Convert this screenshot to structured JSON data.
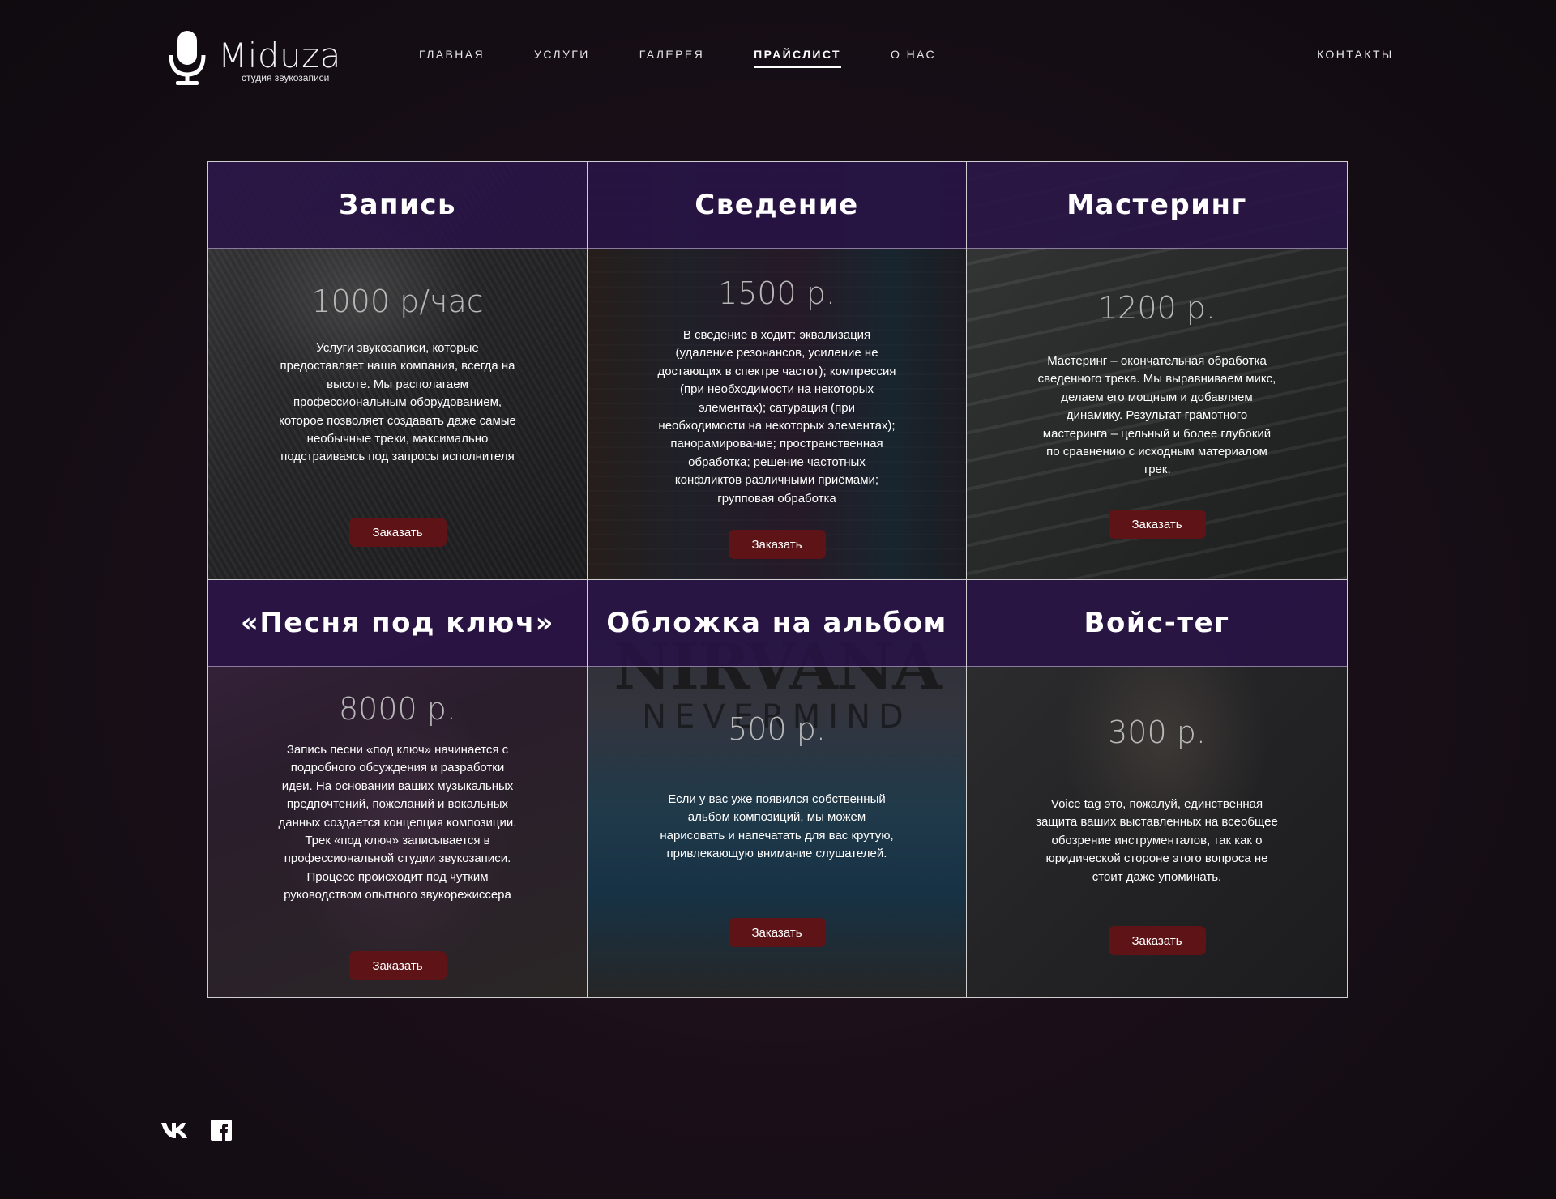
{
  "brand": {
    "name": "Miduza",
    "tagline": "студия звукозаписи"
  },
  "nav": {
    "items": [
      {
        "label": "ГЛАВНАЯ"
      },
      {
        "label": "УСЛУГИ"
      },
      {
        "label": "ГАЛЕРЕЯ"
      },
      {
        "label": "ПРАЙСЛИСТ",
        "active": true
      },
      {
        "label": "О НАС"
      }
    ],
    "contacts": "КОНТАКТЫ"
  },
  "cards": [
    {
      "title": "Запись",
      "price": "1000 р/час",
      "description": "Услуги звукозаписи, которые предоставляет наша компания, всегда на высоте. Мы располагаем профессиональным оборудованием, которое позволяет создавать даже самые необычные треки, максимально подстраиваясь под запросы исполнителя",
      "button": "Заказать"
    },
    {
      "title": "Сведение",
      "price": "1500 р.",
      "description": "В сведение в ходит: эквализация (удаление резонансов, усиление не достающих в спектре частот); компрессия (при необходимости на некоторых элементах); сатурация (при необходимости на некоторых элементах); панорамирование; пространственная обработка; решение частотных конфликтов различными приёмами; групповая обработка",
      "button": "Заказать"
    },
    {
      "title": "Мастеринг",
      "price": "1200 р.",
      "description": "Мастеринг – окончательная обработка сведенного трека. Мы выравниваем микс, делаем его мощным и добавляем динамику. Результат грамотного мастеринга – цельный и более глубокий по сравнению с исходным материалом трек.",
      "button": "Заказать"
    },
    {
      "title": "«Песня под ключ»",
      "price": "8000 р.",
      "description": "Запись песни «под ключ» начинается с подробного обсуждения и разработки идеи. На основании ваших музыкальных предпочтений, пожеланий и вокальных данных создается концепция композиции. Трек «под ключ» записывается в профессиональной студии звукозаписи. Процесс происходит под чутким руководством опытного звукорежиссера",
      "button": "Заказать"
    },
    {
      "title": "Обложка на альбом",
      "price": "500 р.",
      "description": "Если у вас уже появился собственный альбом композиций, мы можем нарисовать и напечатать для вас крутую, привлекающую внимание слушателей.",
      "button": "Заказать",
      "image_text": {
        "band": "NIRVANA",
        "album": "NEVERMIND"
      }
    },
    {
      "title": "Войс-тег",
      "price": "300 р.",
      "description": "Voice tag это, пожалуй, единственная защита ваших выставленных на всеобщее обозрение инструменталов, так как о юридической стороне этого вопроса не стоит даже упоминать.",
      "button": "Заказать"
    }
  ],
  "social": {
    "icons": [
      "vk-icon",
      "facebook-icon"
    ]
  },
  "colors": {
    "button_bg": "#5e1417",
    "card_header_bg": "#28124699",
    "background": "#1a0f19"
  }
}
